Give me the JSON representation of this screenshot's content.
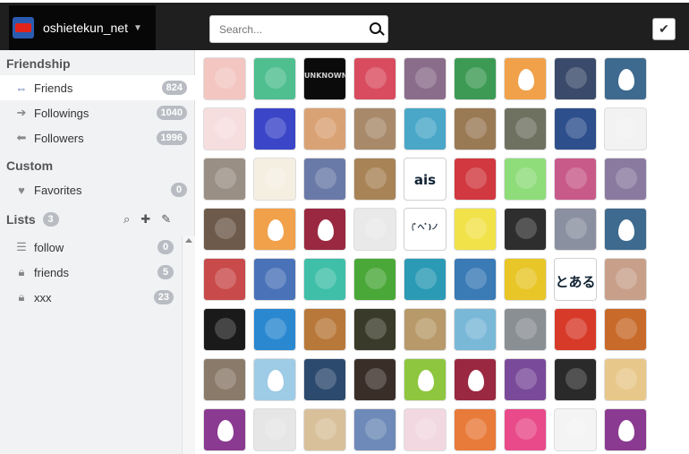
{
  "account": {
    "name": "oshietekun_net"
  },
  "search": {
    "placeholder": "Search..."
  },
  "sidebar": {
    "friendship_title": "Friendship",
    "friendship": [
      {
        "label": "Friends",
        "count": "824",
        "icon": "double-arrow-icon",
        "active": true
      },
      {
        "label": "Followings",
        "count": "1040",
        "icon": "arrow-right-icon"
      },
      {
        "label": "Followers",
        "count": "1996",
        "icon": "arrow-left-icon"
      }
    ],
    "custom_title": "Custom",
    "custom": [
      {
        "label": "Favorites",
        "count": "0",
        "icon": "heart-icon"
      }
    ],
    "lists_title": "Lists",
    "lists_count": "3",
    "lists": [
      {
        "label": "follow",
        "count": "0",
        "icon": "list-icon"
      },
      {
        "label": "friends",
        "count": "5",
        "icon": "lock-icon"
      },
      {
        "label": "xxx",
        "count": "23",
        "icon": "lock-icon"
      }
    ]
  },
  "colors": {
    "topbar": "#1f1f1f",
    "accent": "#5a6fb0",
    "badge": "#b9bcc3"
  },
  "avatars": [
    {
      "type": "photo",
      "color": "#f3c6c2"
    },
    {
      "type": "photo",
      "color": "#4fbf8f"
    },
    {
      "type": "text",
      "color": "#0b0b0b",
      "label": "UNKNOWN"
    },
    {
      "type": "photo",
      "color": "#d94c5f"
    },
    {
      "type": "photo",
      "color": "#8a6d8a"
    },
    {
      "type": "photo",
      "color": "#3c9a54"
    },
    {
      "type": "egg",
      "color": "#f0a14a"
    },
    {
      "type": "photo",
      "color": "#3a4a6a"
    },
    {
      "type": "egg",
      "color": "#3d6a8e"
    },
    {
      "type": "photo",
      "color": "#f7dede"
    },
    {
      "type": "photo",
      "color": "#3a45c8"
    },
    {
      "type": "photo",
      "color": "#d9a274"
    },
    {
      "type": "photo",
      "color": "#a88a6a"
    },
    {
      "type": "photo",
      "color": "#4aa7c8"
    },
    {
      "type": "photo",
      "color": "#9a7a55"
    },
    {
      "type": "photo",
      "color": "#6e7160"
    },
    {
      "type": "photo",
      "color": "#2d4f8c"
    },
    {
      "type": "photo",
      "color": "#f2f2f2"
    },
    {
      "type": "photo",
      "color": "#9a8f85"
    },
    {
      "type": "photo",
      "color": "#f5efe2"
    },
    {
      "type": "photo",
      "color": "#6a7aa8"
    },
    {
      "type": "photo",
      "color": "#a88356"
    },
    {
      "type": "text",
      "color": "#ffffff",
      "label": "ais"
    },
    {
      "type": "photo",
      "color": "#d1383f"
    },
    {
      "type": "photo",
      "color": "#8fdc7a"
    },
    {
      "type": "photo",
      "color": "#c85a8a"
    },
    {
      "type": "photo",
      "color": "#8a7aa0"
    },
    {
      "type": "photo",
      "color": "#6d5a4a"
    },
    {
      "type": "egg",
      "color": "#f0a14a"
    },
    {
      "type": "egg",
      "color": "#9a2840"
    },
    {
      "type": "photo",
      "color": "#e9e9e9"
    },
    {
      "type": "text",
      "color": "#ffffff",
      "label": "(ﾟへﾟ)ノ"
    },
    {
      "type": "photo",
      "color": "#f2e24a"
    },
    {
      "type": "photo",
      "color": "#2e2e2e"
    },
    {
      "type": "photo",
      "color": "#8a90a0"
    },
    {
      "type": "egg",
      "color": "#3d6a8e"
    },
    {
      "type": "photo",
      "color": "#c94a4a"
    },
    {
      "type": "photo",
      "color": "#4a72b8"
    },
    {
      "type": "photo",
      "color": "#3fbfa8"
    },
    {
      "type": "photo",
      "color": "#4aa838"
    },
    {
      "type": "photo",
      "color": "#2a9ab5"
    },
    {
      "type": "photo",
      "color": "#3a7ab5"
    },
    {
      "type": "photo",
      "color": "#e8c628"
    },
    {
      "type": "text",
      "color": "#ffffff",
      "label": "とある"
    },
    {
      "type": "photo",
      "color": "#c8a08a"
    },
    {
      "type": "photo",
      "color": "#1a1a1a"
    },
    {
      "type": "photo",
      "color": "#2a88d0"
    },
    {
      "type": "photo",
      "color": "#b8783a"
    },
    {
      "type": "photo",
      "color": "#3a3a2a"
    },
    {
      "type": "photo",
      "color": "#b89a6a"
    },
    {
      "type": "photo",
      "color": "#7ab8d8"
    },
    {
      "type": "photo",
      "color": "#8a8f94"
    },
    {
      "type": "photo",
      "color": "#d83a2a"
    },
    {
      "type": "photo",
      "color": "#c86a2a"
    },
    {
      "type": "photo",
      "color": "#8a7a6a"
    },
    {
      "type": "egg",
      "color": "#9ecbe5"
    },
    {
      "type": "photo",
      "color": "#2c4a6e"
    },
    {
      "type": "photo",
      "color": "#3a2e28"
    },
    {
      "type": "egg",
      "color": "#8ec63f"
    },
    {
      "type": "egg",
      "color": "#9a2840"
    },
    {
      "type": "photo",
      "color": "#7a4a9a"
    },
    {
      "type": "photo",
      "color": "#2a2a2a"
    },
    {
      "type": "photo",
      "color": "#e8c88a"
    },
    {
      "type": "egg",
      "color": "#8a3a90"
    },
    {
      "type": "photo",
      "color": "#e6e6e6"
    },
    {
      "type": "photo",
      "color": "#d8c09a"
    },
    {
      "type": "photo",
      "color": "#6e8ab8"
    },
    {
      "type": "photo",
      "color": "#f2d8e0"
    },
    {
      "type": "photo",
      "color": "#e87a3a"
    },
    {
      "type": "photo",
      "color": "#e84a8a"
    },
    {
      "type": "photo",
      "color": "#f4f4f4"
    },
    {
      "type": "egg",
      "color": "#8a3a90"
    }
  ]
}
